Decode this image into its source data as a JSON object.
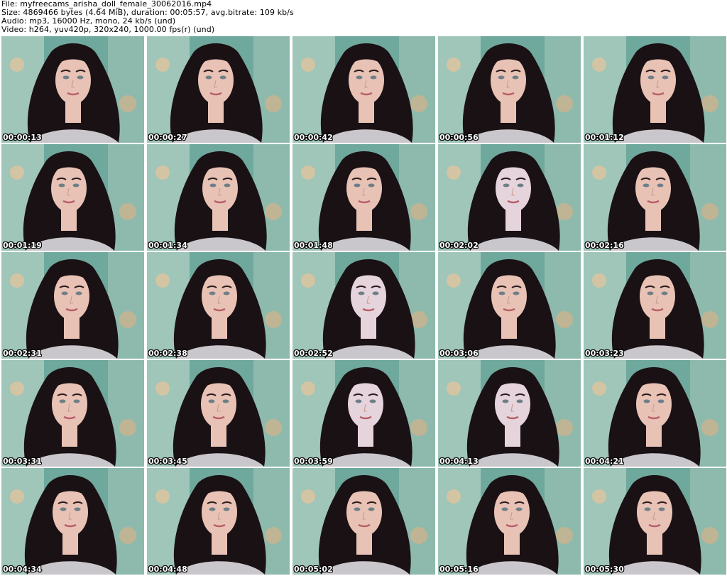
{
  "header": {
    "file_line": "File: myfreecams_arisha_doll_female_30062016.mp4",
    "size_line": "Size: 4869466 bytes (4.64 MiB), duration: 00:05:57, avg.bitrate: 109 kb/s",
    "audio_line": "Audio: mp3, 16000 Hz, mono, 24 kb/s (und)",
    "video_line": "Video: h264, yuv420p, 320x240, 1000.00 fps(r) (und)"
  },
  "thumbnails": [
    {
      "timestamp": "00:00:13",
      "tone": "warm"
    },
    {
      "timestamp": "00:00:27",
      "tone": "warm"
    },
    {
      "timestamp": "00:00:42",
      "tone": "warm"
    },
    {
      "timestamp": "00:00:56",
      "tone": "warm"
    },
    {
      "timestamp": "00:01:12",
      "tone": "warm"
    },
    {
      "timestamp": "00:01:19",
      "tone": "warm"
    },
    {
      "timestamp": "00:01:34",
      "tone": "warm"
    },
    {
      "timestamp": "00:01:48",
      "tone": "warm"
    },
    {
      "timestamp": "00:02:02",
      "tone": "cool"
    },
    {
      "timestamp": "00:02:16",
      "tone": "warm"
    },
    {
      "timestamp": "00:02:31",
      "tone": "warm"
    },
    {
      "timestamp": "00:02:38",
      "tone": "warm"
    },
    {
      "timestamp": "00:02:52",
      "tone": "cool"
    },
    {
      "timestamp": "00:03:06",
      "tone": "warm"
    },
    {
      "timestamp": "00:03:23",
      "tone": "warm"
    },
    {
      "timestamp": "00:03:31",
      "tone": "warm"
    },
    {
      "timestamp": "00:03:45",
      "tone": "warm"
    },
    {
      "timestamp": "00:03:59",
      "tone": "cool"
    },
    {
      "timestamp": "00:04:13",
      "tone": "cool"
    },
    {
      "timestamp": "00:04:21",
      "tone": "warm"
    },
    {
      "timestamp": "00:04:34",
      "tone": "warm"
    },
    {
      "timestamp": "00:04:48",
      "tone": "warm"
    },
    {
      "timestamp": "00:05:02",
      "tone": "warm"
    },
    {
      "timestamp": "00:05:16",
      "tone": "warm"
    },
    {
      "timestamp": "00:05:30",
      "tone": "warm"
    }
  ],
  "colors": {
    "background": "#ffffff",
    "backdrop_teal": "#6fa89c",
    "backdrop_light": "#c9ddd2",
    "hair": "#1a1114",
    "skin_warm": "#e9c2b6",
    "skin_cool": "#e6d4dc",
    "shirt": "#c9c7cb",
    "timestamp_text": "#ffffff",
    "timestamp_outline": "#000000"
  }
}
